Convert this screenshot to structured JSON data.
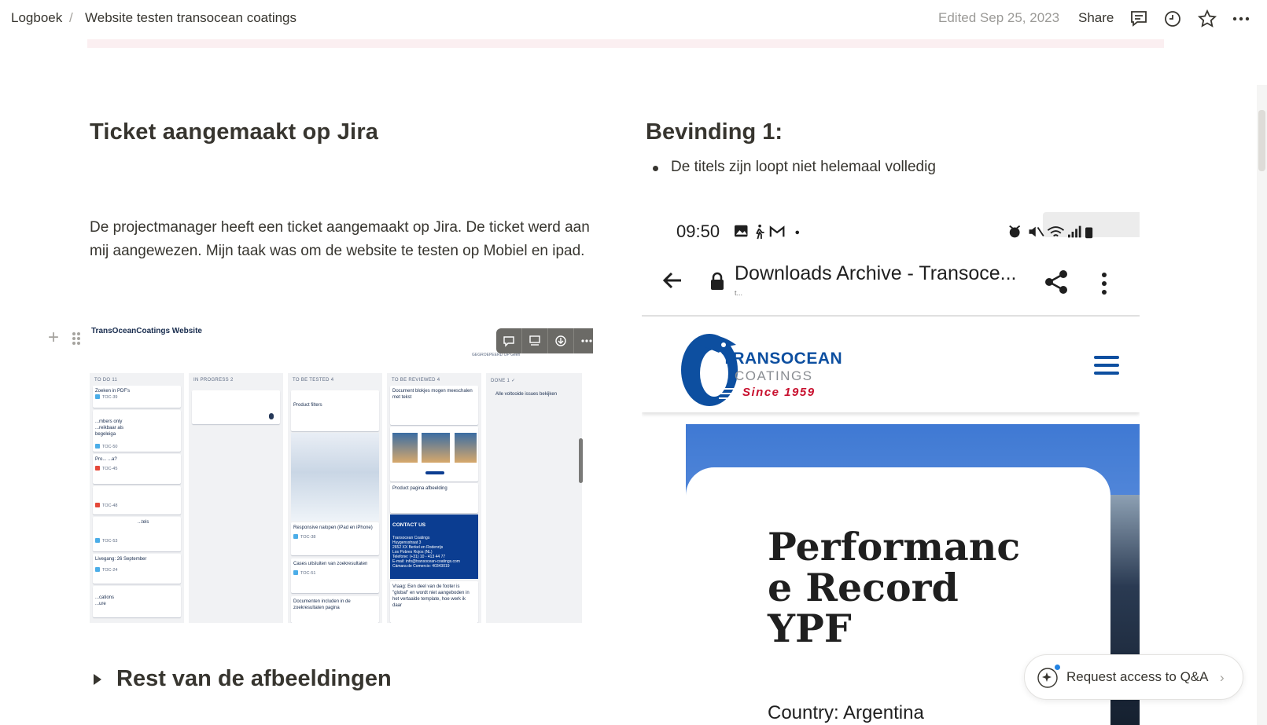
{
  "topbar": {
    "breadcrumb_root": "Logboek",
    "breadcrumb_sep": "/",
    "breadcrumb_page": "Website testen transocean coatings",
    "edited": "Edited Sep 25, 2023",
    "share": "Share"
  },
  "left": {
    "heading": "Ticket aangemaakt op Jira",
    "paragraph": "De projectmanager heeft een ticket aangemaakt op Jira. De ticket werd aan mij aangewezen. Mijn taak was om de website te testen op Mobiel en ipad.",
    "jira": {
      "title": "TransOceanCoatings Website",
      "columns": [
        {
          "name": "TO DO 11"
        },
        {
          "name": "IN PROGRESS 2"
        },
        {
          "name": "TO BE TESTED 4"
        },
        {
          "name": "TO BE REVIEWED 4"
        },
        {
          "name": "DONE 1 ✓"
        }
      ],
      "todo_cards": [
        {
          "text": "Zoeken in PDF's",
          "key": "TOC-39"
        },
        {
          "text": "...mbers only\n...reikbaar als\nbegeleiga",
          "key": "TOC-50"
        },
        {
          "text": "Pro... ...a?",
          "key": "TOC-45"
        },
        {
          "text": "",
          "key": "TOC-48"
        },
        {
          "text": "...tels",
          "key": "TOC-53"
        },
        {
          "text": "Livegang: 26 September",
          "key": "TOC-24"
        },
        {
          "text": "...cations\n...ure",
          "key": ""
        }
      ],
      "tested_cards": [
        {
          "text": "Product filters",
          "key": ""
        },
        {
          "text": "Responsive nalopen (iPad en iPhone)",
          "key": "TOC-38"
        },
        {
          "text": "Cases uitsluiten van zoekresultaten",
          "key": "TOC-51"
        },
        {
          "text": "Documenten includen in de zoekresultaten pagina",
          "key": ""
        }
      ],
      "review_cards": [
        {
          "text": "Document blokjes mogen meeschalen met tekst",
          "key": ""
        },
        {
          "text": "Product pagina afbeelding",
          "key": ""
        },
        {
          "text": "CONTACT US",
          "key": ""
        },
        {
          "text": "Vraag: Een deel van de footer is \"global\" en wordt niet aangeboden in het vertaalde template, hoe werk ik daar",
          "key": ""
        }
      ],
      "contact_lines": "Transocean Coatings\nHuygensstraat 3\n2652 XX Berkel en Rodenrijs\nLos Pobres Rojos (NL)\nTelefone: (+31) 10 - 413 44 77\nE-mail: info@transocean-coatings.com\nCámara de Comercio: 40343019",
      "done_text": "Alle voltooide issues bekijken",
      "view_hint": "GEGROEPEERD OP Geen"
    },
    "toggle_heading": "Rest van de afbeeldingen"
  },
  "right": {
    "heading": "Bevinding 1:",
    "bullet": "De titels zijn loopt niet helemaal volledig",
    "phone": {
      "time": "09:50",
      "url": "Downloads Archive - Transoce...",
      "url_sub": "t...",
      "logo_line1": "TRANSOCEAN",
      "logo_line2": "COATINGS",
      "logo_line3": "Since 1959",
      "title": "Performanc e Record YPF",
      "country": "Country: Argentina"
    }
  },
  "qa_button": {
    "label": "Request access to Q&A"
  },
  "colors": {
    "accent": "#2383e2",
    "text": "#37352f",
    "brand_blue": "#0d4fa0",
    "brand_red": "#c8102e"
  }
}
